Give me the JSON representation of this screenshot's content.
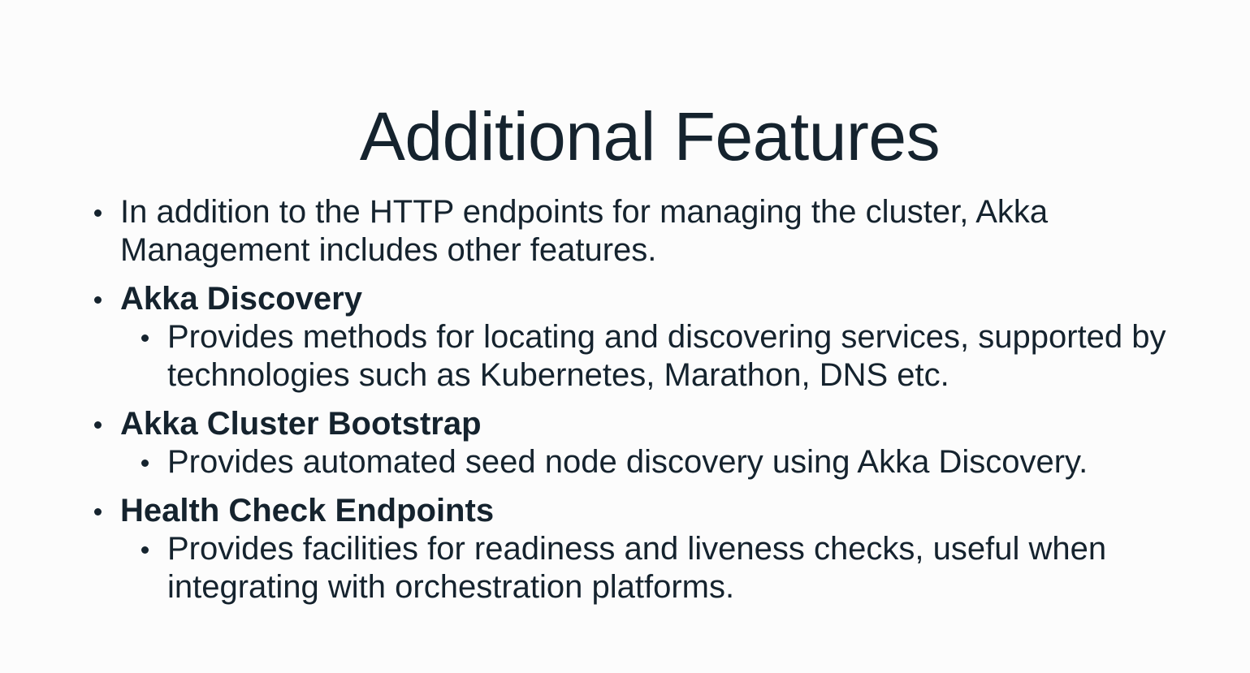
{
  "slide": {
    "title": "Additional Features",
    "items": [
      {
        "text": "In addition to the HTTP endpoints for managing the cluster, Akka Management includes other features."
      },
      {
        "heading": "Akka Discovery",
        "sub": "Provides methods for locating and discovering services, supported by technologies such as Kubernetes, Marathon, DNS etc."
      },
      {
        "heading": "Akka Cluster Bootstrap",
        "sub": "Provides automated seed node discovery using Akka Discovery."
      },
      {
        "heading": "Health Check Endpoints",
        "sub": "Provides facilities for readiness and liveness checks, useful when integrating with orchestration platforms."
      }
    ]
  }
}
